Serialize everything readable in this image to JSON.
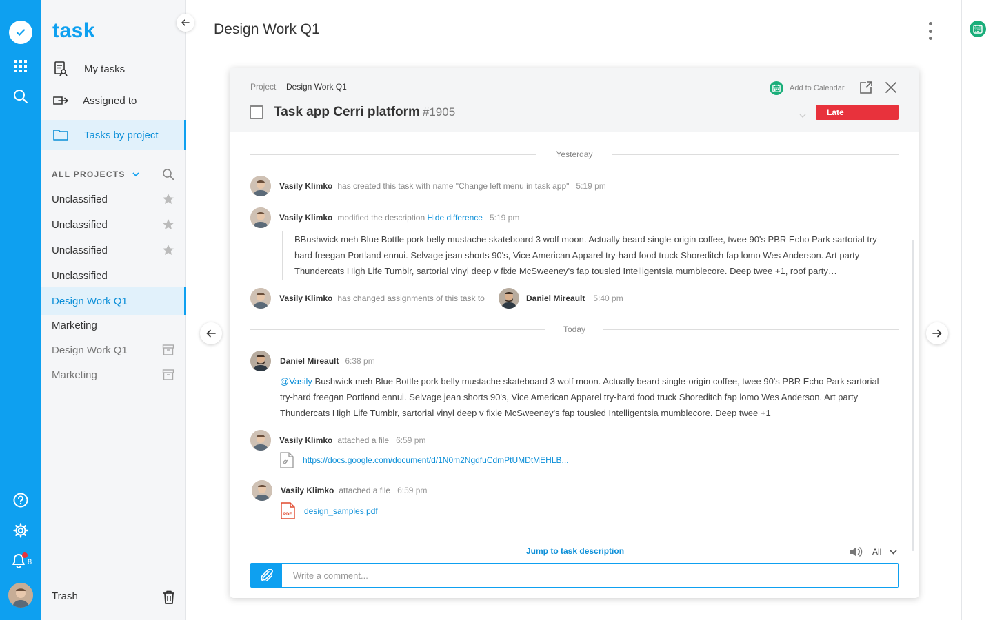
{
  "app": {
    "logo": "task",
    "notification_count": "8"
  },
  "sidebar": {
    "nav": [
      {
        "label": "My tasks",
        "icon": "my-tasks-icon"
      },
      {
        "label": "Assigned to",
        "icon": "assigned-to-icon"
      },
      {
        "label": "Tasks by project",
        "icon": "folder-icon"
      }
    ],
    "projects_header": "ALL PROJECTS",
    "projects": [
      {
        "label": "Unclassified",
        "icon": "star-icon"
      },
      {
        "label": "Unclassified",
        "icon": "star-icon"
      },
      {
        "label": "Unclassified",
        "icon": "star-icon"
      },
      {
        "label": "Unclassified",
        "icon": ""
      },
      {
        "label": "Design Work Q1",
        "icon": "",
        "active": true
      },
      {
        "label": "Marketing",
        "icon": ""
      },
      {
        "label": "Design Work Q1",
        "icon": "archive-icon",
        "archived": true
      },
      {
        "label": "Marketing",
        "icon": "archive-icon",
        "archived": true
      }
    ],
    "trash": "Trash"
  },
  "page": {
    "title": "Design Work Q1"
  },
  "task": {
    "crumb_label": "Project",
    "crumb_value": "Design Work Q1",
    "add_calendar": "Add to Calendar",
    "title": "Task app Cerri platform",
    "number": "#1905",
    "status": "Late"
  },
  "activity": {
    "day1": "Yesterday",
    "day2": "Today",
    "events": [
      {
        "user": "Vasily Klimko",
        "action": "has created this task with name \"Change left menu in task app\"",
        "time": "5:19 pm"
      },
      {
        "user": "Vasily Klimko",
        "action": "modified the description",
        "link": "Hide difference",
        "time": "5:19 pm",
        "quote": "BBushwick meh Blue Bottle pork belly mustache skateboard 3 wolf moon. Actually beard single-origin coffee, twee 90's PBR Echo Park sartorial try-hard freegan Portland ennui. Selvage jean shorts 90's,  Vice American Apparel try-hard food truck Shoreditch fap lomo Wes Anderson. Art party Thundercats High Life Tumblr, sartorial vinyl deep v fixie McSweeney's fap tousled Intelligentsia mumblecore. Deep  twee +1, roof party…"
      },
      {
        "user": "Vasily Klimko",
        "action": "has changed assignments of this task to",
        "assignee": "Daniel Mireault",
        "time": "5:40 pm"
      },
      {
        "user": "Daniel Mireault",
        "time": "6:38 pm",
        "mention": "@Vasily",
        "comment": " Bushwick meh Blue Bottle pork belly mustache skateboard 3 wolf moon. Actually beard single-origin coffee, twee 90's PBR Echo Park sartorial try-hard freegan Portland ennui. Selvage jean shorts 90's,  Vice American Apparel try-hard food truck Shoreditch fap lomo Wes Anderson. Art party Thundercats High Life Tumblr, sartorial vinyl deep v fixie McSweeney's fap tousled Intelligentsia mumblecore. Deep  twee +1"
      },
      {
        "user": "Vasily Klimko",
        "action": "attached a file",
        "time": "6:59 pm",
        "file": "https://docs.google.com/document/d/1N0m2NgdfuCdmPtUMDtMEHLB..."
      },
      {
        "user": "Vasily Klimko",
        "action": "attached a file",
        "time": "6:59 pm",
        "file": "design_samples.pdf",
        "file_badge": "PDF"
      }
    ]
  },
  "footer": {
    "jump": "Jump to task description",
    "filter": "All",
    "comment_placeholder": "Write a comment..."
  },
  "colors": {
    "accent": "#0ea0f0",
    "late": "#e8323c",
    "calendar": "#1aae7a"
  }
}
